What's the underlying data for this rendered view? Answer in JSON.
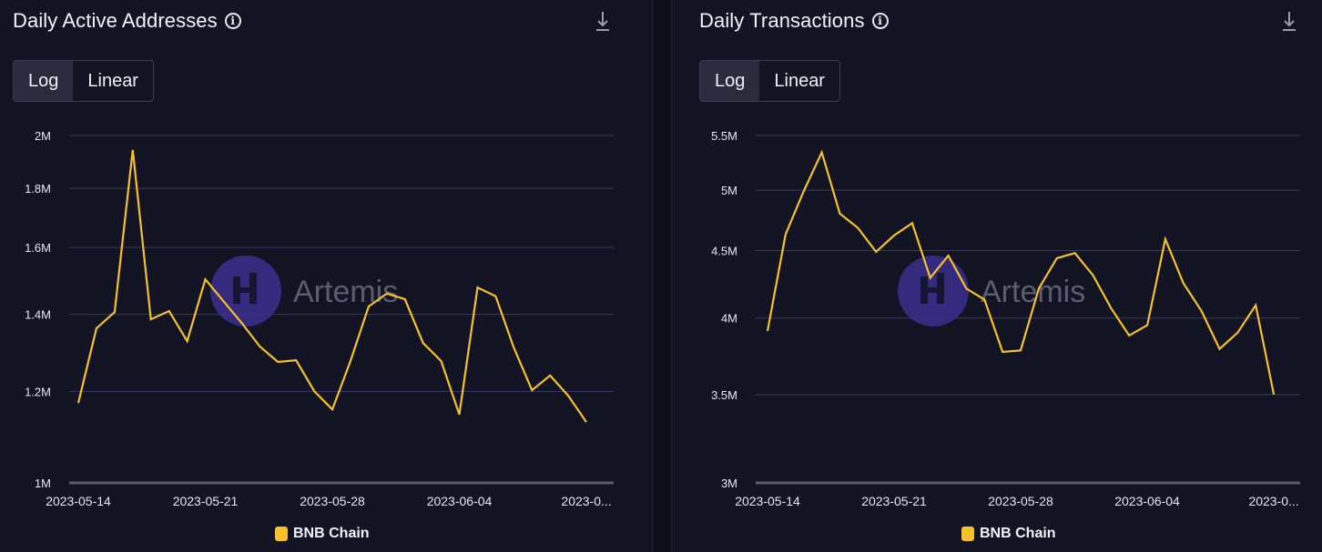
{
  "panels": [
    {
      "title": "Daily Active Addresses",
      "info_icon": "info-circle-icon",
      "download_icon": "download-icon",
      "toggle": {
        "options": [
          "Log",
          "Linear"
        ],
        "selected": "Log"
      },
      "watermark": "Artemis",
      "legend": [
        {
          "label": "BNB Chain",
          "color": "#f5c02c"
        }
      ]
    },
    {
      "title": "Daily Transactions",
      "info_icon": "info-circle-icon",
      "download_icon": "download-icon",
      "toggle": {
        "options": [
          "Log",
          "Linear"
        ],
        "selected": "Log"
      },
      "watermark": "Artemis",
      "legend": [
        {
          "label": "BNB Chain",
          "color": "#f5c02c"
        }
      ]
    }
  ],
  "chart_data": [
    {
      "type": "line",
      "title": "Daily Active Addresses",
      "xlabel": "",
      "ylabel": "",
      "yscale": "log",
      "ylim": [
        1000000,
        2000000
      ],
      "yticks": [
        1000000,
        1200000,
        1400000,
        1600000,
        1800000,
        2000000
      ],
      "ytick_labels": [
        "1M",
        "1.2M",
        "1.4M",
        "1.6M",
        "1.8M",
        "2M"
      ],
      "xtick_labels": [
        "2023-05-14",
        "2023-05-21",
        "2023-05-28",
        "2023-06-04",
        "2023-0..."
      ],
      "xtick_index": [
        0,
        7,
        14,
        21,
        28
      ],
      "grid": true,
      "legend_position": "bottom-center",
      "x_start": "2023-05-14",
      "series": [
        {
          "name": "BNB Chain",
          "color": "#f5c02c",
          "values": [
            1173000,
            1361000,
            1406000,
            1943000,
            1386000,
            1409000,
            1327000,
            1501000,
            1437000,
            1376000,
            1313000,
            1273000,
            1277000,
            1201000,
            1158000,
            1275000,
            1422000,
            1459000,
            1443000,
            1322000,
            1275000,
            1146000,
            1477000,
            1451000,
            1310000,
            1203000,
            1239000,
            1190000,
            1129000
          ]
        }
      ]
    },
    {
      "type": "line",
      "title": "Daily Transactions",
      "xlabel": "",
      "ylabel": "",
      "yscale": "log",
      "ylim": [
        3000000,
        5500000
      ],
      "yticks": [
        3000000,
        3500000,
        4000000,
        4500000,
        5000000,
        5500000
      ],
      "ytick_labels": [
        "3M",
        "3.5M",
        "4M",
        "4.5M",
        "5M",
        "5.5M"
      ],
      "xtick_labels": [
        "2023-05-14",
        "2023-05-21",
        "2023-05-28",
        "2023-06-04",
        "2023-0..."
      ],
      "xtick_index": [
        0,
        7,
        14,
        21,
        28
      ],
      "grid": true,
      "legend_position": "bottom-center",
      "x_start": "2023-05-14",
      "series": [
        {
          "name": "BNB Chain",
          "color": "#f5c02c",
          "values": [
            3910000,
            4630000,
            4990000,
            5340000,
            4800000,
            4680000,
            4490000,
            4620000,
            4720000,
            4290000,
            4460000,
            4210000,
            4130000,
            3770000,
            3780000,
            4210000,
            4440000,
            4480000,
            4310000,
            4070000,
            3880000,
            3950000,
            4590000,
            4250000,
            4050000,
            3790000,
            3900000,
            4090000,
            3500000
          ]
        }
      ]
    }
  ]
}
